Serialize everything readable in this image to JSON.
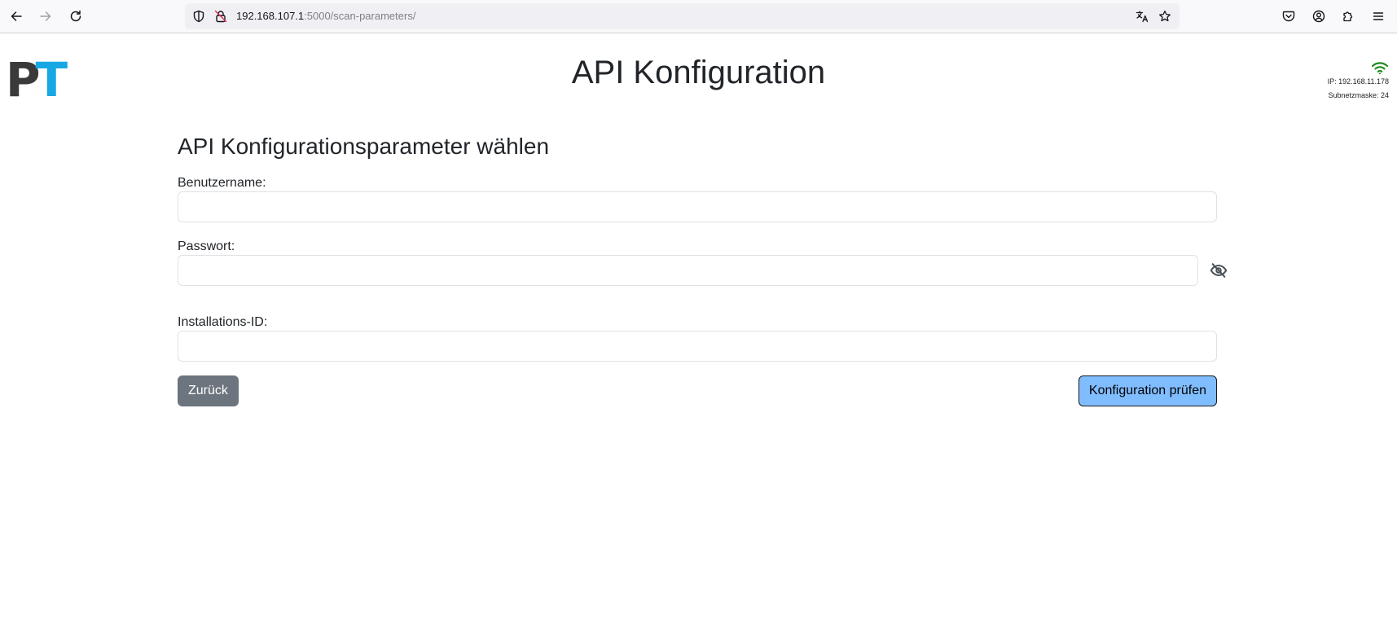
{
  "browser": {
    "url_host": "192.168.107.1",
    "url_rest": ":5000/scan-parameters/"
  },
  "header": {
    "logo_p": "P",
    "logo_t": "T",
    "title": "API Konfiguration",
    "ip_text": "IP: 192.168.11.178",
    "subnet_text": "Subnetzmaske: 24"
  },
  "form": {
    "section_title": "API Konfigurationsparameter wählen",
    "username_label": "Benutzername:",
    "username_value": "",
    "password_label": "Passwort:",
    "password_value": "",
    "installation_label": "Installations-ID:",
    "installation_value": "",
    "back_label": "Zurück",
    "check_label": "Konfiguration prüfen"
  },
  "colors": {
    "logo_p": "#3a3a3a",
    "logo_t": "#17a8e3",
    "wifi": "#1f8a1f",
    "back_button": "#6c757d",
    "check_button": "#80bdff"
  },
  "icons": {
    "back": "arrow-left-icon",
    "forward": "arrow-right-icon",
    "reload": "reload-icon",
    "shield": "shield-icon",
    "insecure": "insecure-lock-icon",
    "translate": "translate-icon",
    "bookmark": "star-icon",
    "pocket": "pocket-icon",
    "account": "account-icon",
    "extensions": "puzzle-icon",
    "menu": "hamburger-menu-icon",
    "wifi": "wifi-icon",
    "password_toggle": "eye-slash-icon"
  }
}
